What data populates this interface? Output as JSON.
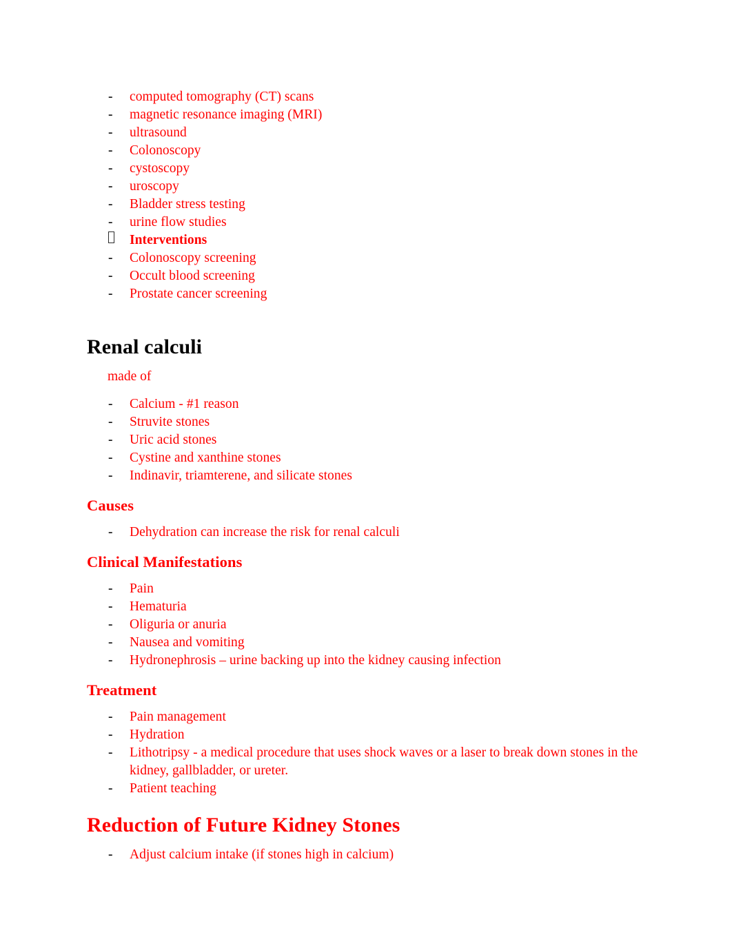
{
  "document": {
    "text_color": "#ff0000",
    "heading_black": "#000000",
    "bullet_glyph": "-",
    "tofu_glyph": ""
  },
  "top_list": {
    "items": [
      {
        "bullet": "-",
        "text": "computed tomography (CT) scans",
        "style": "normal"
      },
      {
        "bullet": "-",
        "text": "magnetic resonance imaging (MRI)",
        "style": "normal"
      },
      {
        "bullet": "-",
        "text": "ultrasound",
        "style": "normal"
      },
      {
        "bullet": "-",
        "text": "Colonoscopy",
        "style": "normal"
      },
      {
        "bullet": "-",
        "text": "cystoscopy",
        "style": "normal"
      },
      {
        "bullet": "-",
        "text": "uroscopy",
        "style": "normal"
      },
      {
        "bullet": "-",
        "text": "Bladder stress testing",
        "style": "normal"
      },
      {
        "bullet": "-",
        "text": "urine flow studies",
        "style": "normal"
      },
      {
        "bullet": "tofu",
        "text": "Interventions",
        "style": "bold"
      },
      {
        "bullet": "-",
        "text": "Colonoscopy screening",
        "style": "normal"
      },
      {
        "bullet": "-",
        "text": "Occult blood screening",
        "style": "normal"
      },
      {
        "bullet": "-",
        "text": "Prostate cancer screening",
        "style": "normal"
      }
    ]
  },
  "renal_calculi": {
    "heading": "Renal calculi",
    "intro": "made of",
    "made_of": [
      {
        "bullet": "-",
        "text": "Calcium - #1 reason"
      },
      {
        "bullet": "-",
        "text": "Struvite stones"
      },
      {
        "bullet": "-",
        "text": "Uric acid stones"
      },
      {
        "bullet": "-",
        "text": "Cystine and xanthine stones"
      },
      {
        "bullet": "-",
        "text": "Indinavir, triamterene, and silicate stones"
      }
    ]
  },
  "causes": {
    "heading": "Causes",
    "items": [
      {
        "bullet": "-",
        "text": "Dehydration can increase the risk for renal calculi"
      }
    ]
  },
  "clinical_manifestations": {
    "heading": "Clinical Manifestations",
    "items": [
      {
        "bullet": "-",
        "text": "Pain"
      },
      {
        "bullet": "-",
        "text": "Hematuria"
      },
      {
        "bullet": "-",
        "text": "Oliguria or anuria"
      },
      {
        "bullet": "-",
        "text": "Nausea and vomiting"
      },
      {
        "bullet": "-",
        "text": "Hydronephrosis – urine backing up into the kidney causing infection"
      }
    ]
  },
  "treatment": {
    "heading": "Treatment",
    "items": [
      {
        "bullet": "-",
        "text": "Pain management"
      },
      {
        "bullet": "-",
        "text": "Hydration"
      },
      {
        "bullet": "-",
        "text": "Lithotripsy - a medical procedure that uses shock waves or a laser to break down stones in the kidney, gallbladder, or ureter."
      },
      {
        "bullet": "-",
        "text": "Patient teaching"
      }
    ]
  },
  "reduction": {
    "heading": "Reduction of Future Kidney Stones",
    "items": [
      {
        "bullet": "-",
        "text": "Adjust calcium intake (if stones high in calcium)"
      }
    ]
  }
}
